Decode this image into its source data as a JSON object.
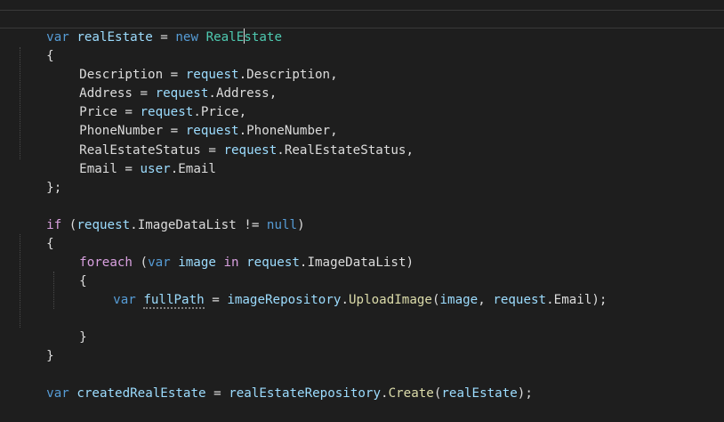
{
  "code": {
    "l1": {
      "kw_var": "var",
      "name": "realEstate",
      "eq": " = ",
      "kw_new": "new",
      "type_a": "RealE",
      "type_b": "state"
    },
    "l2": {
      "text": "{"
    },
    "l3": {
      "prop": "Description",
      "eq": " = ",
      "obj": "request",
      "dot": ".",
      "member": "Description",
      "end": ","
    },
    "l4": {
      "prop": "Address",
      "eq": " = ",
      "obj": "request",
      "dot": ".",
      "member": "Address",
      "end": ","
    },
    "l5": {
      "prop": "Price",
      "eq": " = ",
      "obj": "request",
      "dot": ".",
      "member": "Price",
      "end": ","
    },
    "l6": {
      "prop": "PhoneNumber",
      "eq": " = ",
      "obj": "request",
      "dot": ".",
      "member": "PhoneNumber",
      "end": ","
    },
    "l7": {
      "prop": "RealEstateStatus",
      "eq": " = ",
      "obj": "request",
      "dot": ".",
      "member": "RealEstateStatus",
      "end": ","
    },
    "l8": {
      "prop": "Email",
      "eq": " = ",
      "obj": "user",
      "dot": ".",
      "member": "Email",
      "end": ""
    },
    "l9": {
      "text": "};"
    },
    "l11": {
      "kw_if": "if",
      "open": " (",
      "obj": "request",
      "dot": ".",
      "member": "ImageDataList",
      "op": " != ",
      "kw_null": "null",
      "close": ")"
    },
    "l12": {
      "text": "{"
    },
    "l13": {
      "kw_foreach": "foreach",
      "open": " (",
      "kw_var": "var",
      "loc": " image ",
      "kw_in": "in",
      "sp": " ",
      "obj": "request",
      "dot": ".",
      "member": "ImageDataList",
      "close": ")"
    },
    "l14": {
      "text": "{"
    },
    "l15": {
      "kw_var": "var",
      "sp": " ",
      "loc": "fullPath",
      "eq": " = ",
      "obj": "imageRepository",
      "dot": ".",
      "method": "UploadImage",
      "open": "(",
      "arg1": "image",
      "comma": ", ",
      "obj2": "request",
      "dot2": ".",
      "member2": "Email",
      "close": ");"
    },
    "l17": {
      "text": "}"
    },
    "l18": {
      "text": "}"
    },
    "l20": {
      "kw_var": "var",
      "sp": " ",
      "loc": "createdRealEstate",
      "eq": " = ",
      "obj": "realEstateRepository",
      "dot": ".",
      "method": "Create",
      "open": "(",
      "arg": "realEstate",
      "close": ");"
    }
  }
}
